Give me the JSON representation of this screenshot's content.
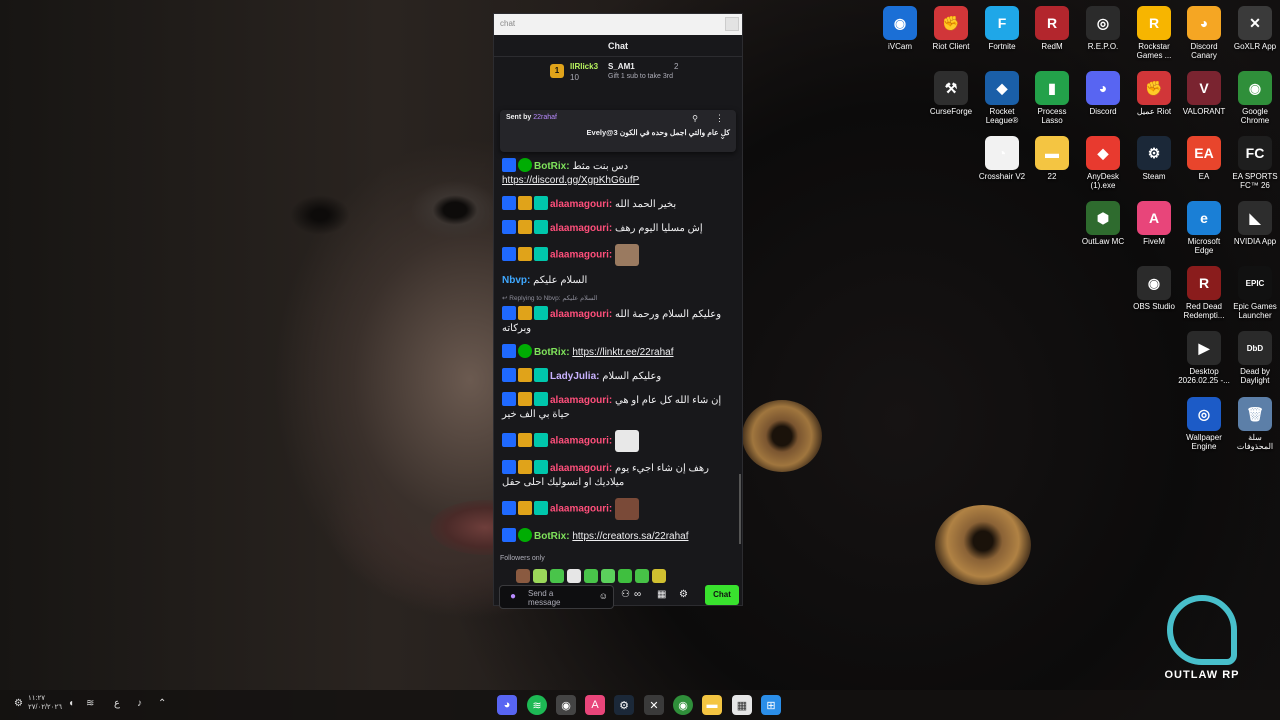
{
  "chat_window": {
    "tab_title": "chat",
    "header": "Chat",
    "leaderboard": {
      "rank": "1",
      "user1": "IlRlick3",
      "user1_count": "10",
      "user2": "S_AM1",
      "user2_sub": "Gift 1 sub to take 3rd",
      "user2_count": "2"
    },
    "pinned": {
      "sent_by_label": "Sent by",
      "sent_by_user": "22rahaf",
      "message": "كل عام والتي اجمل وحده في الكون 3@Evely"
    },
    "messages": [
      {
        "badges": [
          "mod",
          "verified"
        ],
        "user": "BotRix",
        "color": "#7fe35b",
        "text": "دس بنت مثط",
        "link": "https://discord.gg/XgpKhG6ufP"
      },
      {
        "badges": [
          "mod",
          "crown",
          "sub"
        ],
        "user": "alaamagouri",
        "color": "#ff4f7b",
        "text": "بخير الحمد الله"
      },
      {
        "badges": [
          "mod",
          "crown",
          "sub"
        ],
        "user": "alaamagouri",
        "color": "#ff4f7b",
        "text": "إش مسليا اليوم رهف"
      },
      {
        "badges": [
          "mod",
          "crown",
          "sub"
        ],
        "user": "alaamagouri",
        "color": "#ff4f7b",
        "text": "",
        "emote": "#9a7a60"
      },
      {
        "badges": [],
        "user": "Nbvp",
        "color": "#3fa8ff",
        "text": "السلام عليكم"
      },
      {
        "badges": [
          "mod",
          "crown",
          "sub"
        ],
        "user": "alaamagouri",
        "color": "#ff4f7b",
        "reply": "Replying to Nbvp: السلام عليكم",
        "text": "وعليكم السلام ورحمة الله وبركاته"
      },
      {
        "badges": [
          "mod",
          "verified"
        ],
        "user": "BotRix",
        "color": "#7fe35b",
        "text": "",
        "link": "https://linktr.ee/22rahaf"
      },
      {
        "badges": [
          "mod",
          "crown",
          "sub"
        ],
        "user": "LadyJulia",
        "color": "#c9b2ff",
        "text": "وعليكم السلام"
      },
      {
        "badges": [
          "mod",
          "crown",
          "sub"
        ],
        "user": "alaamagouri",
        "color": "#ff4f7b",
        "text": "إن شاء الله كل عام او هي حياة بي الف خير"
      },
      {
        "badges": [
          "mod",
          "crown",
          "sub"
        ],
        "user": "alaamagouri",
        "color": "#ff4f7b",
        "text": "",
        "emote": "#e8e8e8"
      },
      {
        "badges": [
          "mod",
          "crown",
          "sub"
        ],
        "user": "alaamagouri",
        "color": "#ff4f7b",
        "text": "رهف إن شاء اجيء يوم ميلاديك او انسوليك احلى حفل"
      },
      {
        "badges": [
          "mod",
          "crown",
          "sub"
        ],
        "user": "alaamagouri",
        "color": "#ff4f7b",
        "text": "",
        "emote": "#7a4a38"
      },
      {
        "badges": [
          "mod",
          "verified"
        ],
        "user": "BotRix",
        "color": "#7fe35b",
        "text": "",
        "link": "https://creators.sa/22rahaf"
      }
    ],
    "followers_only": "Followers only",
    "input_placeholder": "Send a message",
    "chat_button": "Chat"
  },
  "desktop_icons": [
    {
      "label": "iVCam",
      "color": "#1b6fd6",
      "glyph": "◉"
    },
    {
      "label": "Riot Client",
      "color": "#d13639",
      "glyph": "✊"
    },
    {
      "label": "Fortnite",
      "color": "#1fa7e8",
      "glyph": "F"
    },
    {
      "label": "RedM",
      "color": "#b3262d",
      "glyph": "R"
    },
    {
      "label": "R.E.P.O.",
      "color": "#2b2b2b",
      "glyph": "◎"
    },
    {
      "label": "Rockstar Games ...",
      "color": "#f7b500",
      "glyph": "R"
    },
    {
      "label": "Discord Canary",
      "color": "#f5a623",
      "glyph": "◕"
    },
    {
      "label": "GoXLR App",
      "color": "#3a3a3a",
      "glyph": "✕"
    },
    {
      "label": "CurseForge",
      "color": "#2e2e2e",
      "glyph": "⚒"
    },
    {
      "label": "Rocket League®",
      "color": "#1a5fa8",
      "glyph": "◆"
    },
    {
      "label": "Process Lasso",
      "color": "#23a14a",
      "glyph": "▮"
    },
    {
      "label": "Discord",
      "color": "#5865f2",
      "glyph": "◕"
    },
    {
      "label": "عميل Riot",
      "color": "#d13639",
      "glyph": "✊"
    },
    {
      "label": "VALORANT",
      "color": "#7a2430",
      "glyph": "V"
    },
    {
      "label": "Google Chrome",
      "color": "#2f8f3a",
      "glyph": "◉"
    },
    {
      "label": "Crosshair V2",
      "color": "#f2f2f2",
      "glyph": "◔"
    },
    {
      "label": "22",
      "color": "#f4c542",
      "glyph": "▬"
    },
    {
      "label": "AnyDesk (1).exe",
      "color": "#e83a2f",
      "glyph": "◆"
    },
    {
      "label": "Steam",
      "color": "#1b2838",
      "glyph": "⚙"
    },
    {
      "label": "EA",
      "color": "#e8452c",
      "glyph": "EA"
    },
    {
      "label": "EA SPORTS FC™ 26",
      "color": "#1e1e1e",
      "glyph": "FC"
    },
    {
      "label": "OutLaw MC",
      "color": "#2e6b2e",
      "glyph": "⬢"
    },
    {
      "label": "FiveM",
      "color": "#e8457a",
      "glyph": "A"
    },
    {
      "label": "Microsoft Edge",
      "color": "#1a7fd6",
      "glyph": "e"
    },
    {
      "label": "NVIDIA App",
      "color": "#2d2d2d",
      "glyph": "◣"
    },
    {
      "label": "OBS Studio",
      "color": "#2b2b2b",
      "glyph": "◉"
    },
    {
      "label": "Red Dead Redempti...",
      "color": "#8a1c1c",
      "glyph": "R"
    },
    {
      "label": "Epic Games Launcher",
      "color": "#111111",
      "glyph": "EPIC"
    },
    {
      "label": "Desktop 2026.02.25 -...",
      "color": "#2a2a2a",
      "glyph": "▶"
    },
    {
      "label": "Dead by Daylight",
      "color": "#2a2a2a",
      "glyph": "DbD"
    },
    {
      "label": "Wallpaper Engine",
      "color": "#1c5bc7",
      "glyph": "◎"
    },
    {
      "label": "سلة المحذوفات",
      "color": "#5c7fa8",
      "glyph": "🗑"
    }
  ],
  "taskbar": {
    "time": "١١:٢٧",
    "date": "٢٧/٠٢/٢٠٢٦",
    "lang": "ع"
  },
  "logo_text": "OUTLAW RP"
}
